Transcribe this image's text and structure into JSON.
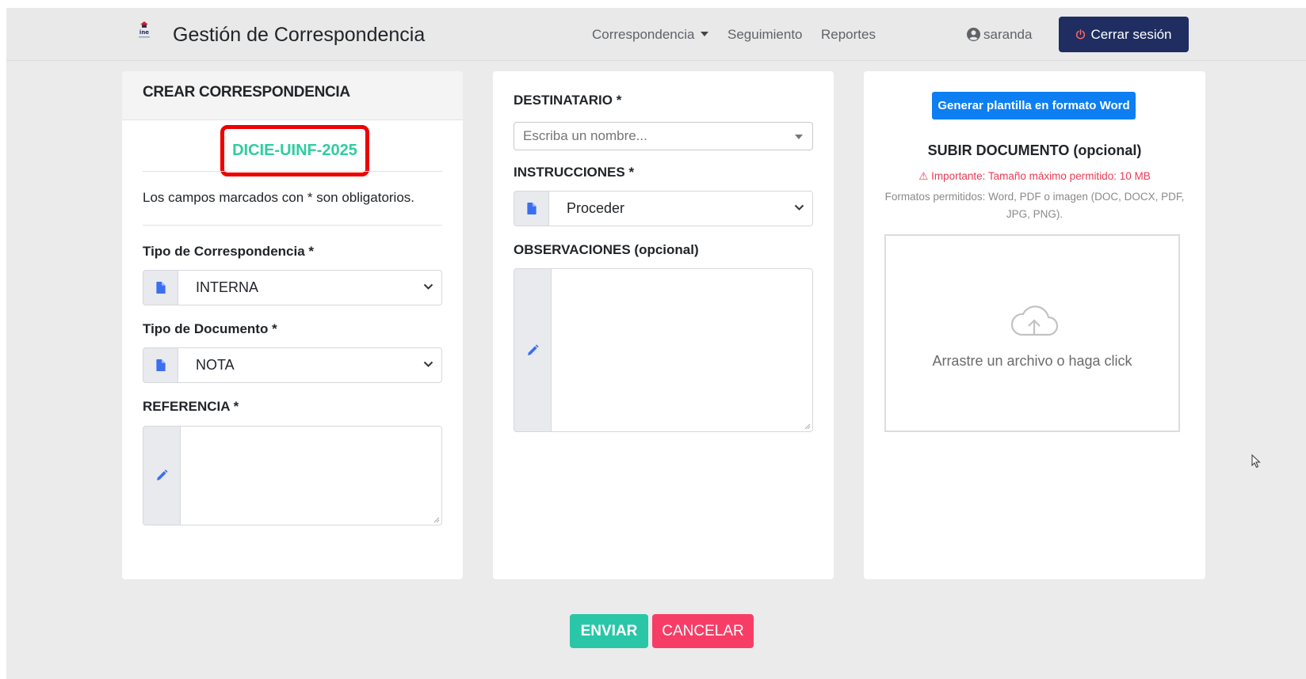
{
  "navbar": {
    "title": "Gestión de Correspondencia",
    "links": [
      "Correspondencia",
      "Seguimiento",
      "Reportes"
    ],
    "user": "saranda",
    "logout_label": "Cerrar sesión",
    "logo_text": "ine"
  },
  "left_card": {
    "header": "CREAR CORRESPONDENCIA",
    "code": "DICIE-UINF-2025",
    "required_note": "Los campos marcados con * son obligatorios.",
    "tipo_correspondencia_label": "Tipo de Correspondencia *",
    "tipo_correspondencia_value": "INTERNA",
    "tipo_documento_label": "Tipo de Documento *",
    "tipo_documento_value": "NOTA",
    "referencia_label": "REFERENCIA *",
    "referencia_value": ""
  },
  "middle_card": {
    "destinatario_label": "DESTINATARIO *",
    "destinatario_placeholder": "Escriba un nombre...",
    "instrucciones_label": "INSTRUCCIONES *",
    "instrucciones_value": "Proceder",
    "observaciones_label": "OBSERVACIONES (opcional)",
    "observaciones_value": ""
  },
  "right_card": {
    "word_button": "Generar plantilla en formato Word",
    "upload_title": "SUBIR DOCUMENTO (opcional)",
    "warning": "⚠ Importante: Tamaño máximo permitido: 10 MB",
    "formats": "Formatos permitidos: Word, PDF o imagen (DOC, DOCX, PDF, JPG, PNG).",
    "dropzone_text": "Arrastre un archivo o haga click"
  },
  "actions": {
    "send_label": "ENVIAR",
    "cancel_label": "CANCELAR"
  },
  "colors": {
    "navy": "#1f2d61",
    "teal": "#29c7a7",
    "code": "#2ecda0",
    "pink": "#f73d66",
    "blue": "#0d7ff2",
    "highlight": "#ee0000",
    "icon_blue": "#3c6ff0"
  }
}
